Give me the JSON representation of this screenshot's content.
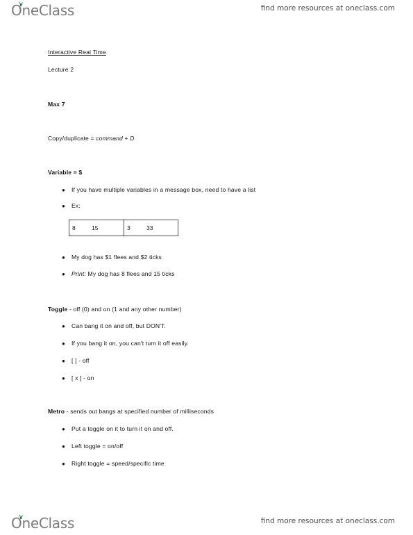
{
  "watermark": {
    "brand_name": "OneClass",
    "leaf_color": "#2e7d46",
    "brand_color": "#7b7b7b",
    "tagline": "find more resources at oneclass.com"
  },
  "document": {
    "title": "Interactive Real Time",
    "subtitle": "Lecture 2",
    "software": "Max 7",
    "shortcut": {
      "prefix": "Copy/duplicate = ",
      "key1": "command",
      "plus": " + ",
      "key2": "D"
    },
    "sections": [
      {
        "heading": "Variable = $",
        "bullets": [
          "If you have multiple variables in a message box, need to have a list",
          "Ex:"
        ],
        "table": {
          "cells": [
            {
              "left": "8",
              "right": "15"
            },
            {
              "left": "3",
              "right": "33"
            }
          ]
        },
        "post_bullets": [
          {
            "italic": "",
            "text": "My dog has $1 flees and $2 ticks"
          },
          {
            "italic": "Print:",
            "text": " My dog has 8 flees and 15 ticks"
          }
        ]
      },
      {
        "heading_bold": "Toggle",
        "heading_rest": " - off (0) and on (1 and any other number)",
        "bullets": [
          "Can bang it on and off, but DON'T.",
          "If you bang it on, you can't turn it off easily.",
          "[   ] - off",
          "[ x ] - on"
        ]
      },
      {
        "heading_bold": "Metro",
        "heading_rest": " - sends out bangs at specified number of milliseconds",
        "bullets": [
          "Put a toggle on it to turn it on and off.",
          "Left toggle = on/off",
          "Right toggle = speed/specific time"
        ]
      }
    ]
  }
}
